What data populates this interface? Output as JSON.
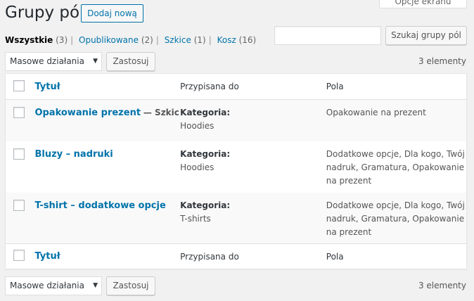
{
  "screen_options": "Opcje ekranu",
  "title": "Grupy pól",
  "add_new": "Dodaj nową",
  "views": [
    {
      "label": "Wszystkie",
      "count": "(3)"
    },
    {
      "label": "Opublikowane",
      "count": "(2)"
    },
    {
      "label": "Szkice",
      "count": "(1)"
    },
    {
      "label": "Kosz",
      "count": "(16)"
    }
  ],
  "search": {
    "button": "Szukaj grupy pól",
    "value": ""
  },
  "bulk": {
    "label": "Masowe działania",
    "apply": "Zastosuj"
  },
  "item_count": "3 elementy",
  "columns": {
    "title": "Tytuł",
    "assigned": "Przypisana do",
    "fields": "Pola"
  },
  "rows": [
    {
      "title": "Opakowanie prezent",
      "state": "— Szkic",
      "assigned_label": "Kategoria:",
      "assigned_value": "Hoodies",
      "fields": "Opakowanie na prezent"
    },
    {
      "title": "Bluzy – nadruki",
      "state": "",
      "assigned_label": "Kategoria:",
      "assigned_value": "Hoodies",
      "fields": "Dodatkowe opcje, Dla kogo, Twój nadruk, Gramatura, Opakowanie na prezent"
    },
    {
      "title": "T-shirt – dodatkowe opcje",
      "state": "",
      "assigned_label": "Kategoria:",
      "assigned_value": "T-shirts",
      "fields": "Dodatkowe opcje, Dla kogo, Twój nadruk, Gramatura, Opakowanie na prezent"
    }
  ],
  "colors": {
    "link": "#0073aa",
    "background": "#f1f1f1",
    "text": "#444444"
  }
}
